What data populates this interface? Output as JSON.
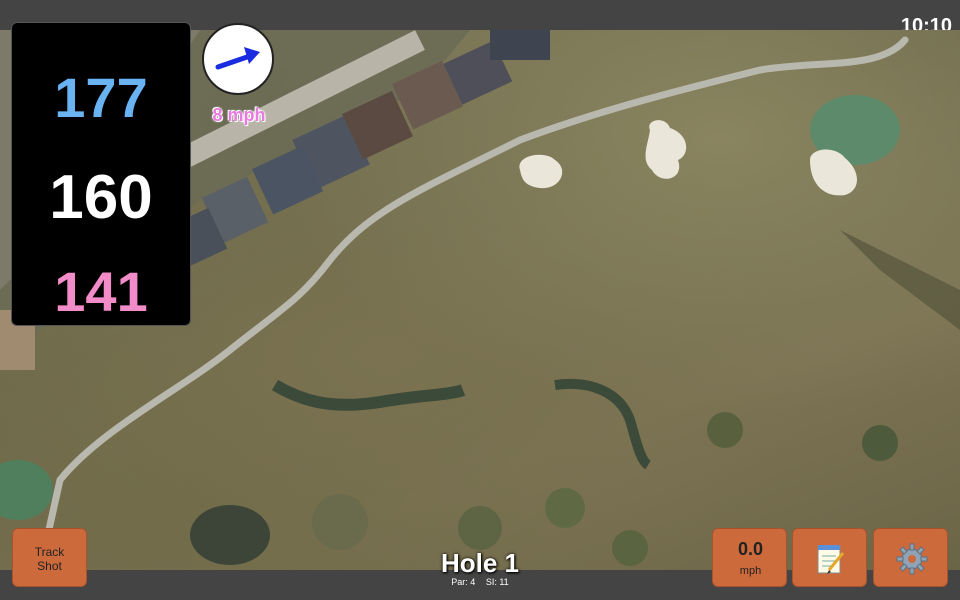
{
  "status": {
    "time": "10:10"
  },
  "distances": {
    "front": "177",
    "center": "160",
    "back": "141"
  },
  "wind": {
    "speed_label": "8 mph",
    "arrow_icon": "wind-direction-arrow-icon"
  },
  "buttons": {
    "track_shot_line1": "Track",
    "track_shot_line2": "Shot",
    "wind_value": "0.0",
    "wind_unit": "mph",
    "notes_icon": "notepad-icon",
    "settings_icon": "gear-icon"
  },
  "hole": {
    "title": "Hole 1",
    "par": "Par: 4",
    "si": "SI: 11"
  },
  "colors": {
    "front": "#6ab3f2",
    "center": "#ffffff",
    "back": "#f28cc8",
    "button": "#cd6a3c",
    "wind_label": "#e87ae0"
  }
}
